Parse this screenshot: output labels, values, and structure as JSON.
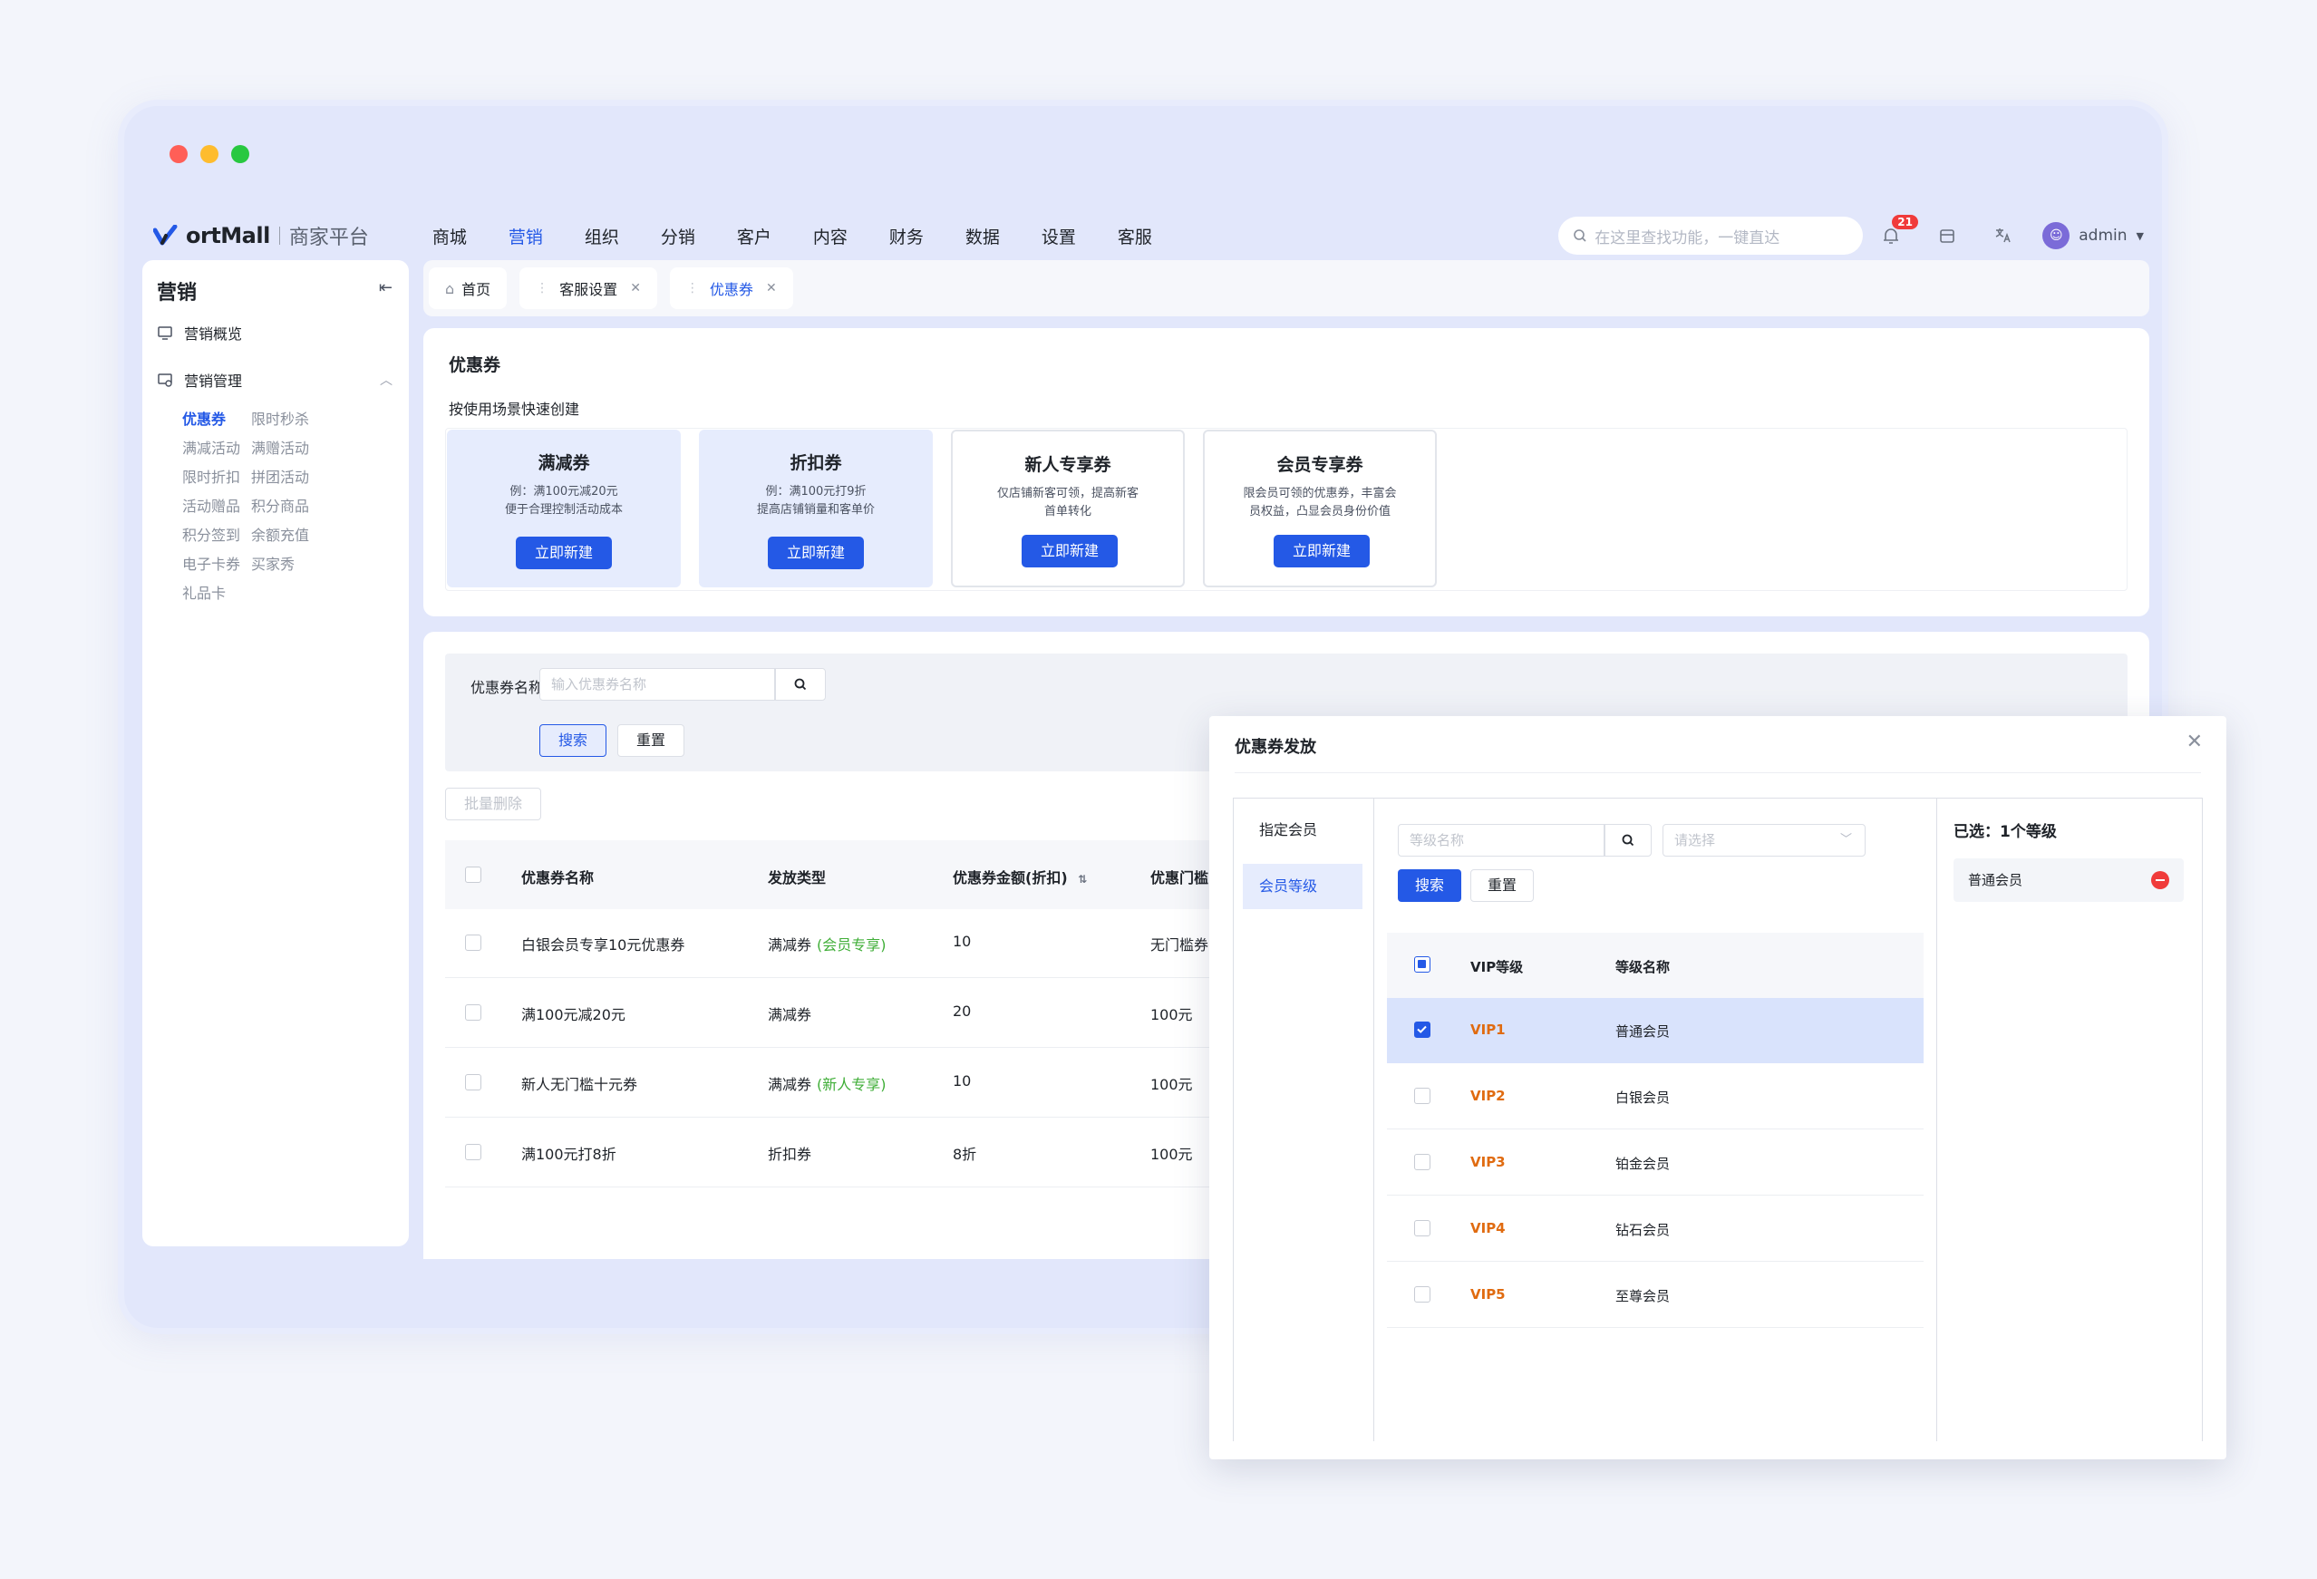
{
  "brand": {
    "logo_text": "ortMall",
    "subtitle": "商家平台"
  },
  "nav": {
    "items": [
      "商城",
      "营销",
      "组织",
      "分销",
      "客户",
      "内容",
      "财务",
      "数据",
      "设置",
      "客服"
    ],
    "active_index": 1
  },
  "top_right": {
    "search_placeholder": "在这里查找功能，一键直达",
    "notification_count": "21",
    "user": "admin"
  },
  "sidebar": {
    "title": "营销",
    "overview": "营销概览",
    "group": "营销管理",
    "sub_items": [
      "优惠券",
      "限时秒杀",
      "满减活动",
      "满赠活动",
      "限时折扣",
      "拼团活动",
      "活动赠品",
      "积分商品",
      "积分签到",
      "余额充值",
      "电子卡券",
      "买家秀",
      "礼品卡"
    ],
    "active_sub": "优惠券"
  },
  "tabs": [
    {
      "label": "首页",
      "icon": "home-icon"
    },
    {
      "label": "客服设置",
      "closable": true
    },
    {
      "label": "优惠券",
      "closable": true,
      "active": true
    }
  ],
  "create_panel": {
    "title": "优惠券",
    "subtitle": "按使用场景快速创建",
    "cards": [
      {
        "name": "满减券",
        "desc1": "例：满100元减20元",
        "desc2": "便于合理控制活动成本",
        "button": "立即新建"
      },
      {
        "name": "折扣券",
        "desc1": "例：满100元打9折",
        "desc2": "提高店铺销量和客单价",
        "button": "立即新建"
      },
      {
        "name": "新人专享券",
        "desc1": "仅店铺新客可领，提高新客",
        "desc2": "首单转化",
        "button": "立即新建"
      },
      {
        "name": "会员专享券",
        "desc1": "限会员可领的优惠券，丰富会",
        "desc2": "员权益，凸显会员身份价值",
        "button": "立即新建"
      }
    ]
  },
  "list_panel": {
    "filter_label": "优惠券名称:",
    "filter_placeholder": "输入优惠券名称",
    "search_btn": "搜索",
    "reset_btn": "重置",
    "batch_delete": "批量删除",
    "columns": [
      "优惠券名称",
      "发放类型",
      "优惠券金额(折扣)",
      "优惠门槛"
    ],
    "rows": [
      {
        "name": "白银会员专享10元优惠券",
        "type": "满减券",
        "tag": "(会员专享)",
        "amount": "10",
        "threshold": "无门槛券"
      },
      {
        "name": "满100元减20元",
        "type": "满减券",
        "tag": "",
        "amount": "20",
        "threshold": "100元"
      },
      {
        "name": "新人无门槛十元券",
        "type": "满减券",
        "tag": "(新人专享)",
        "amount": "10",
        "threshold": "100元"
      },
      {
        "name": "满100元打8折",
        "type": "折扣券",
        "tag": "",
        "amount": "8折",
        "threshold": "100元"
      }
    ]
  },
  "modal": {
    "title": "优惠券发放",
    "left_items": [
      "指定会员",
      "会员等级"
    ],
    "active_left": "会员等级",
    "level_placeholder": "等级名称",
    "select_placeholder": "请选择",
    "search_btn": "搜索",
    "reset_btn": "重置",
    "columns": [
      "VIP等级",
      "等级名称"
    ],
    "rows": [
      {
        "level": "VIP1",
        "name": "普通会员",
        "checked": true
      },
      {
        "level": "VIP2",
        "name": "白银会员",
        "checked": false
      },
      {
        "level": "VIP3",
        "name": "铂金会员",
        "checked": false
      },
      {
        "level": "VIP4",
        "name": "钻石会员",
        "checked": false
      },
      {
        "level": "VIP5",
        "name": "至尊会员",
        "checked": false
      }
    ],
    "selected_title": "已选：1个等级",
    "selected_items": [
      "普通会员"
    ]
  },
  "colors": {
    "primary": "#2459e6",
    "tag_green": "#3fae37",
    "vip_orange": "#e06b10",
    "danger": "#f03b3b"
  }
}
